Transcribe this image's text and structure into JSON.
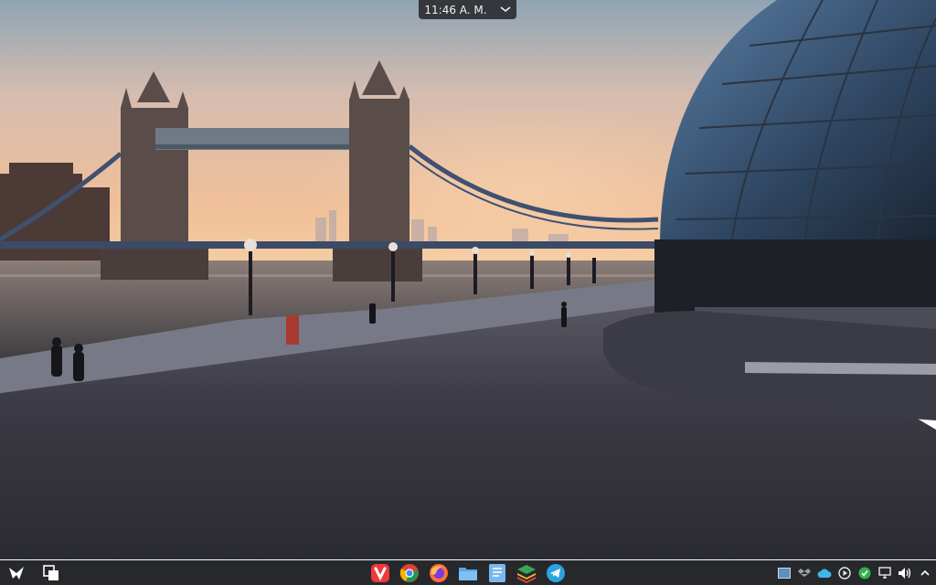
{
  "clock": {
    "time": "11:46 A. M.",
    "chevron": "chevron-down-icon"
  },
  "taskbar": {
    "left": [
      {
        "name": "launcher-icon"
      },
      {
        "name": "show-desktop-icon"
      }
    ],
    "apps": [
      {
        "name": "vivaldi-browser-icon",
        "color": "#ef3939"
      },
      {
        "name": "chrome-browser-icon",
        "color": "#4285f4"
      },
      {
        "name": "firefox-browser-icon",
        "color": "#ff7139"
      },
      {
        "name": "file-manager-icon",
        "color": "#5aa5e6"
      },
      {
        "name": "text-editor-icon",
        "color": "#7ab8ec"
      },
      {
        "name": "layers-app-icon",
        "color": "#3aa655"
      },
      {
        "name": "telegram-icon",
        "color": "#2aa3e0"
      }
    ],
    "tray": [
      {
        "name": "screenshot-tray-icon"
      },
      {
        "name": "dropbox-tray-icon"
      },
      {
        "name": "cloud-tray-icon"
      },
      {
        "name": "media-player-tray-icon"
      },
      {
        "name": "update-ok-tray-icon"
      },
      {
        "name": "display-tray-icon"
      },
      {
        "name": "volume-tray-icon"
      },
      {
        "name": "tray-expand-icon"
      }
    ]
  }
}
